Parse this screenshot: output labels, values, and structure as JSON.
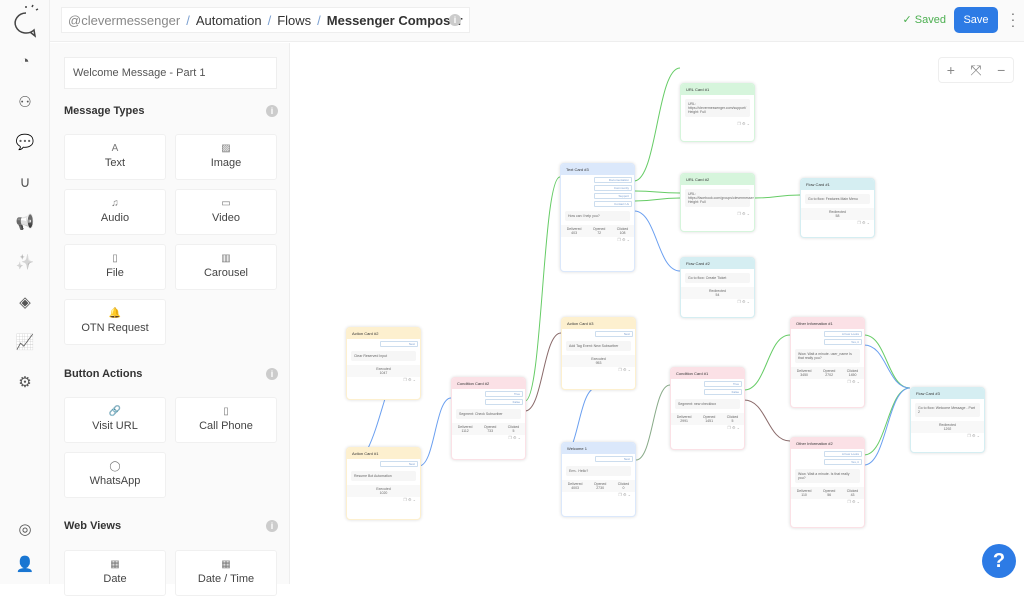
{
  "header": {
    "breadcrumb": [
      "@clevermessenger",
      "Automation",
      "Flows",
      "Messenger Composer"
    ],
    "saved": "Saved",
    "save": "Save"
  },
  "rail": [
    "dashboard-icon",
    "users-icon",
    "chat-icon",
    "magnet-icon",
    "megaphone-icon",
    "magic-wand-icon",
    "layers-icon",
    "analytics-icon",
    "settings-icon",
    "help-ring-icon",
    "profile-icon"
  ],
  "panel": {
    "flow_name": "Welcome Message - Part 1",
    "sections": [
      {
        "title": "Message Types",
        "items": [
          "Text",
          "Image",
          "Audio",
          "Video",
          "File",
          "Carousel",
          "OTN Request"
        ]
      },
      {
        "title": "Button Actions",
        "items": [
          "Visit URL",
          "Call Phone",
          "WhatsApp"
        ]
      },
      {
        "title": "Web Views",
        "items": [
          "Date",
          "Date / Time"
        ]
      }
    ]
  },
  "colors": {
    "accent": "#2d7be5",
    "text": "#dbe8fb",
    "url": "#d6f5dc",
    "flow": "#d5eef2",
    "action": "#fdf0cf",
    "condition": "#fbe1e6",
    "other": "#fbe1e6"
  },
  "cards": [
    {
      "id": "url1",
      "title": "URL Card #1",
      "kind": "url",
      "body": "URL: https://clevermessenger.com/support/ Height: Full"
    },
    {
      "id": "text3",
      "title": "Text Card #3",
      "kind": "text",
      "buttons": [
        "Documentation",
        "Community",
        "Support",
        "Contact Us"
      ],
      "body": "How can I help you?",
      "stats": [
        [
          "Delivered",
          "403"
        ],
        [
          "Opened",
          "72"
        ],
        [
          "Clicked",
          "108"
        ]
      ]
    },
    {
      "id": "url2",
      "title": "URL Card #2",
      "kind": "url",
      "body": "URL: https://facebook.com/groups/clevermessenger Height: Full"
    },
    {
      "id": "flow1",
      "title": "Flow Card #1",
      "kind": "flow",
      "body": "Go to flow: Features Main Menu",
      "stats": [
        [
          "Redirected",
          "58"
        ]
      ]
    },
    {
      "id": "flow2",
      "title": "Flow Card #2",
      "kind": "flow",
      "body": "Go to flow: Create Ticket",
      "stats": [
        [
          "Redirected",
          "54"
        ]
      ]
    },
    {
      "id": "act2",
      "title": "Action Card #2",
      "kind": "action",
      "buttons": [
        "Next"
      ],
      "body": "Clear Reserved Input",
      "stats": [
        [
          "Executed",
          "1047"
        ]
      ]
    },
    {
      "id": "cond2",
      "title": "Condition Card #2",
      "kind": "condition",
      "buttons": [
        "True",
        "False"
      ],
      "body": "Segment: Check Subscriber",
      "stats": [
        [
          "Delivered",
          "1112"
        ],
        [
          "Opened",
          "733"
        ],
        [
          "Clicked",
          "5"
        ]
      ]
    },
    {
      "id": "act3",
      "title": "Action Card #3",
      "kind": "action",
      "buttons": [
        "Next"
      ],
      "body": "Add Tag Event: New Subscriber",
      "stats": [
        [
          "Executed",
          "953"
        ]
      ]
    },
    {
      "id": "cond1",
      "title": "Condition Card #1",
      "kind": "condition",
      "buttons": [
        "True",
        "False"
      ],
      "body": "Segment: new checkbox",
      "stats": [
        [
          "Delivered",
          "2991"
        ],
        [
          "Opened",
          "1451"
        ],
        [
          "Clicked",
          "5"
        ]
      ]
    },
    {
      "id": "oth1",
      "title": "Other Information #1",
      "kind": "other",
      "buttons": [
        "A Few Looks",
        "Yes, it"
      ],
      "body": "Wow. Wait a minute. user_name Is that really you?",
      "stats": [
        [
          "Delivered",
          "3450"
        ],
        [
          "Opened",
          "2702"
        ],
        [
          "Clicked",
          "1450"
        ]
      ]
    },
    {
      "id": "oth2",
      "title": "Other Information #2",
      "kind": "other",
      "buttons": [
        "A Few Looks",
        "Yes, it"
      ],
      "body": "Wow. Wait a minute. Is that really you?",
      "stats": [
        [
          "Delivered",
          "110"
        ],
        [
          "Opened",
          "56"
        ],
        [
          "Clicked",
          "43"
        ]
      ]
    },
    {
      "id": "flow3",
      "title": "Flow Card #3",
      "kind": "flow",
      "body": "Go to flow: Welcome Message - Part 2",
      "stats": [
        [
          "Redirected",
          "1292"
        ]
      ]
    },
    {
      "id": "act1",
      "title": "Action Card #1",
      "kind": "action",
      "buttons": [
        "Next"
      ],
      "body": "Resume Bot Automation",
      "stats": [
        [
          "Executed",
          "1020"
        ]
      ]
    },
    {
      "id": "wel1",
      "title": "Welcome 1",
      "kind": "text",
      "buttons": [
        "Next"
      ],
      "body": "Erm.. Hello?",
      "stats": [
        [
          "Delivered",
          "4003"
        ],
        [
          "Opened",
          "2730"
        ],
        [
          "Clicked",
          "0"
        ]
      ]
    }
  ]
}
